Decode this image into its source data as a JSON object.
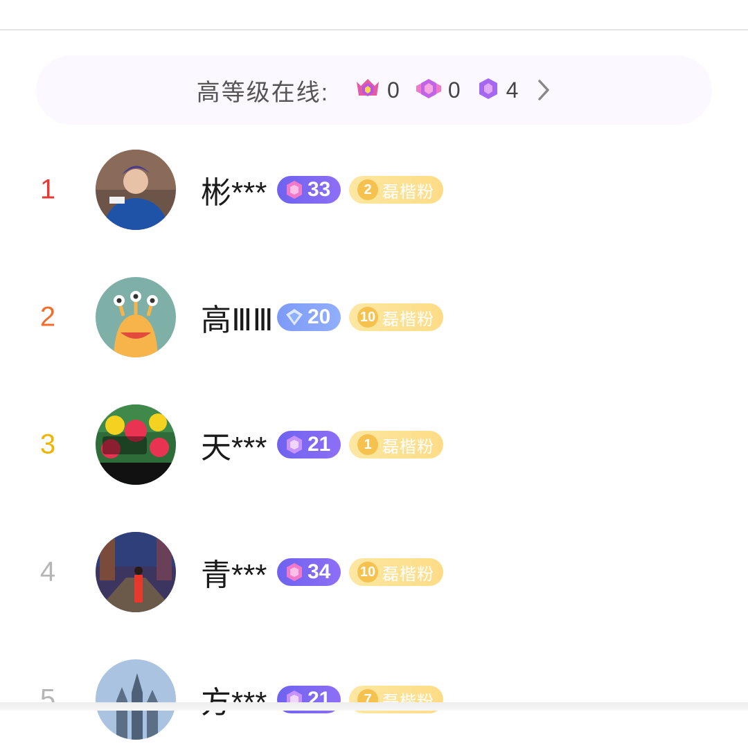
{
  "summary": {
    "label": "高等级在线:",
    "tiers": [
      {
        "icon": "crown-gem-icon",
        "count": "0"
      },
      {
        "icon": "winged-gem-icon",
        "count": "0"
      },
      {
        "icon": "purple-gem-icon",
        "count": "4"
      }
    ]
  },
  "rows": [
    {
      "rank": "1",
      "rank_color": "#e53935",
      "name": "彬***",
      "level": "33",
      "level_style": "purple",
      "fan_level": "2",
      "fan_label": "磊楷粉"
    },
    {
      "rank": "2",
      "rank_color": "#f26c2a",
      "name": "高ⅢⅢ",
      "level": "20",
      "level_style": "blue",
      "fan_level": "10",
      "fan_label": "磊楷粉"
    },
    {
      "rank": "3",
      "rank_color": "#f0b400",
      "name": "天***",
      "level": "21",
      "level_style": "purple",
      "fan_level": "1",
      "fan_label": "磊楷粉"
    },
    {
      "rank": "4",
      "rank_color": "#b5b5b5",
      "name": "青***",
      "level": "34",
      "level_style": "purple",
      "fan_level": "10",
      "fan_label": "磊楷粉"
    },
    {
      "rank": "5",
      "rank_color": "#b5b5b5",
      "name": "方***",
      "level": "21",
      "level_style": "purple",
      "fan_level": "7",
      "fan_label": "磊楷粉"
    }
  ]
}
